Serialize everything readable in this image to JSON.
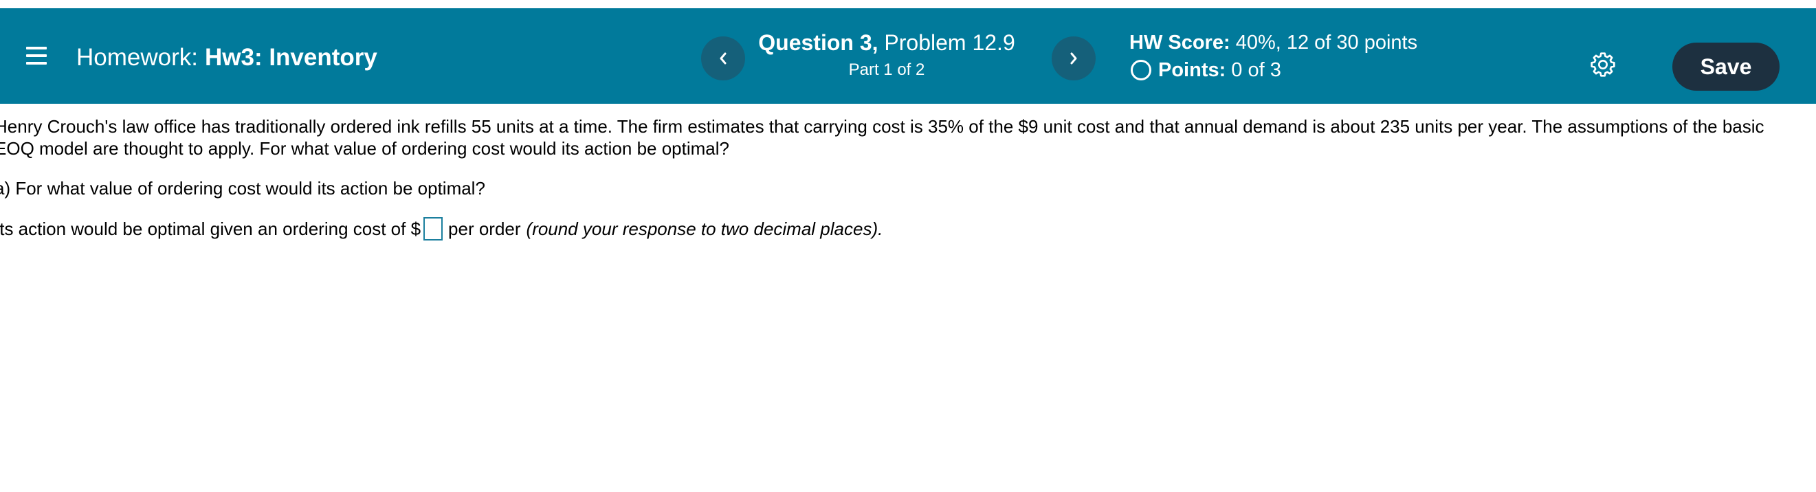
{
  "header": {
    "homework_label": "Homework:",
    "homework_name": "Hw3: Inventory",
    "question_number": "Question 3,",
    "problem": "Problem 12.9",
    "part": "Part 1 of 2",
    "hw_score_label": "HW Score:",
    "hw_score_value": "40%, 12 of 30 points",
    "points_label": "Points:",
    "points_value": "0 of 3",
    "save_label": "Save",
    "colors": {
      "header_bg": "#017a9b",
      "nav_button_bg": "#15607a",
      "save_bg": "#1d3040"
    }
  },
  "icons": {
    "menu": "menu-icon",
    "prev": "chevron-left-icon",
    "next": "chevron-right-icon",
    "status": "circle-icon",
    "settings": "gear-icon"
  },
  "content": {
    "problem_line1": "Henry Crouch's law office has traditionally ordered ink refills 55 units at a time. The firm estimates that carrying cost is 35% of the $9 unit cost and that annual demand is about 235 units per year. The assumptions of the basic",
    "problem_line2": "EOQ model are thought to apply. For what value of ordering cost would its action be optimal?",
    "sub_question": "a) For what value of ordering cost would its action be optimal?",
    "answer_prefix": "Its action would be optimal given an ordering cost of $",
    "answer_value": "",
    "answer_suffix": "per order",
    "answer_hint": "(round your response to two decimal places)."
  }
}
